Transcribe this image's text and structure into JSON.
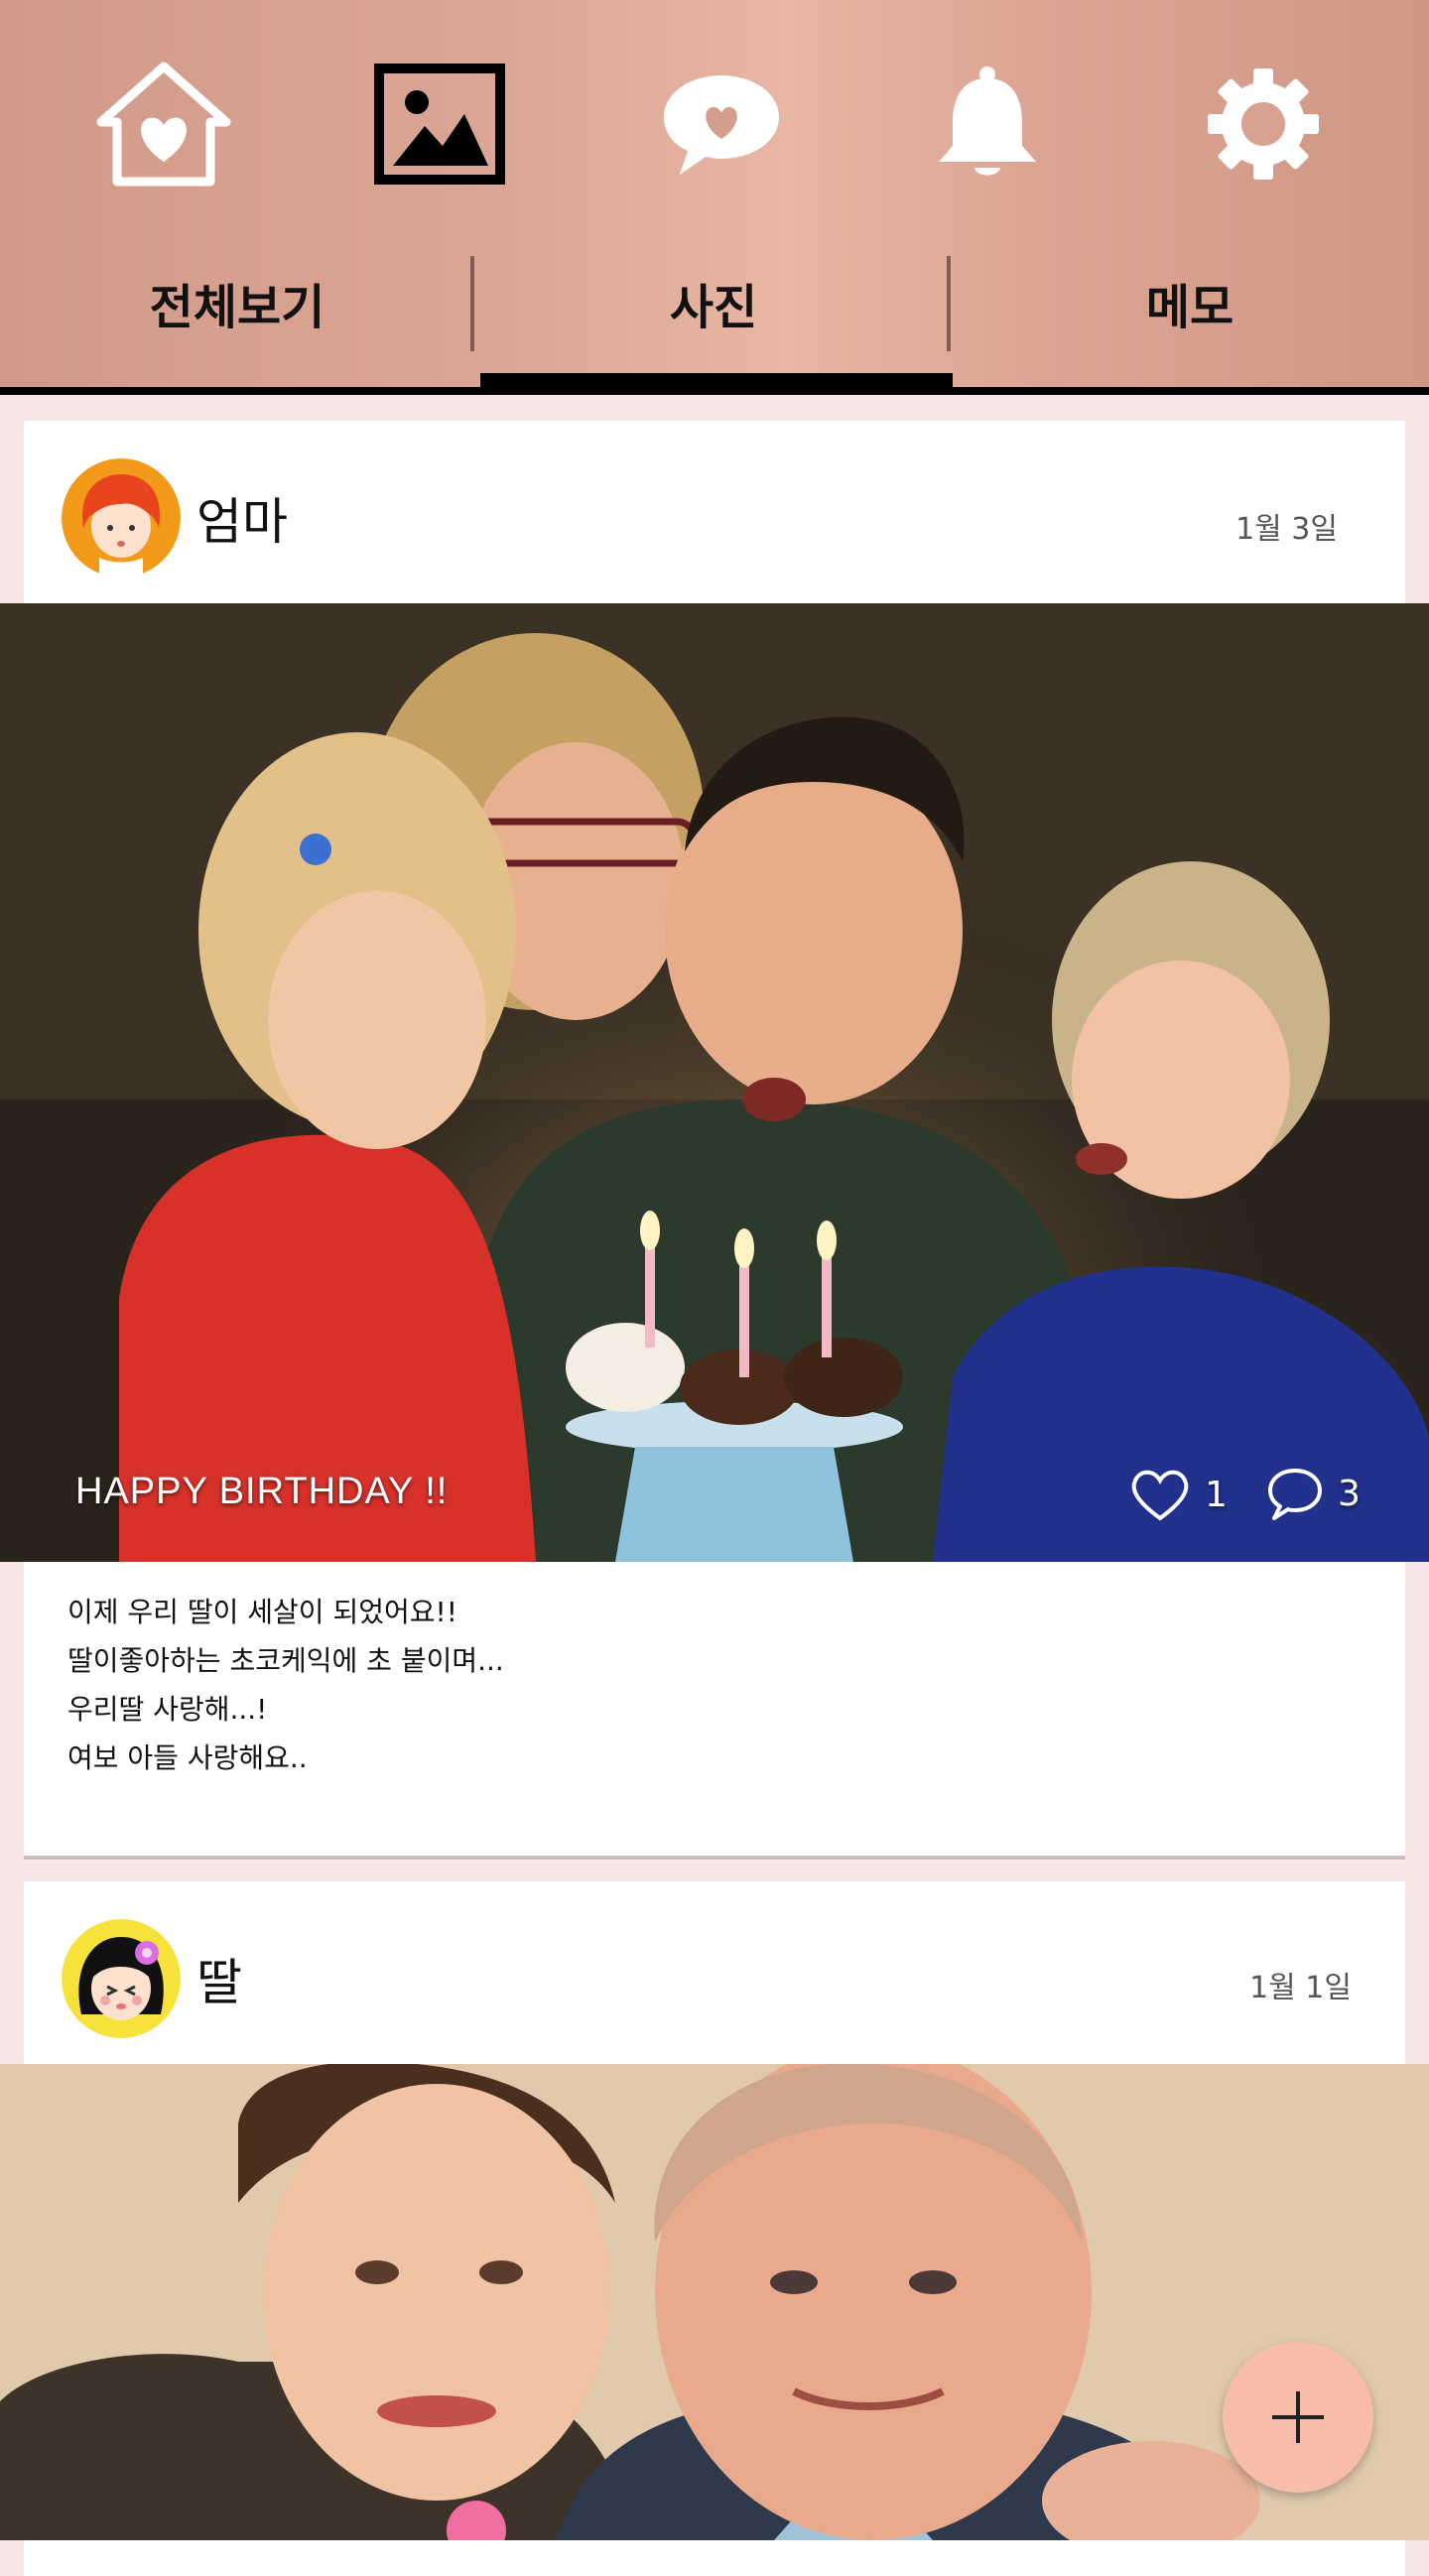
{
  "nav": {
    "icons": [
      "home-heart-icon",
      "photo-icon",
      "chat-heart-icon",
      "bell-icon",
      "gear-icon"
    ],
    "active_icon": "photo-icon",
    "tabs": [
      {
        "label": "전체보기"
      },
      {
        "label": "사진"
      },
      {
        "label": "메모"
      }
    ],
    "active_tab": "사진"
  },
  "posts": [
    {
      "author": "엄마",
      "date": "1월 3일",
      "avatar": "mom-avatar",
      "photo_caption": "HAPPY BIRTHDAY !!",
      "likes": "1",
      "comments": "3",
      "body": [
        "이제 우리 딸이 세살이 되었어요!!",
        "딸이좋아하는 초코케익에 초 붙이며...",
        "우리딸 사랑해...!",
        "여보 아들 사랑해요.."
      ]
    },
    {
      "author": "딸",
      "date": "1월 1일",
      "avatar": "daughter-avatar"
    }
  ],
  "fab": {
    "icon": "plus-icon"
  },
  "colors": {
    "header": "#dca696",
    "background": "#f8e7e6",
    "fab": "#f7bcaa",
    "mom_avatar_bg": "#f39a1a",
    "daughter_avatar_bg": "#f6e23a"
  }
}
